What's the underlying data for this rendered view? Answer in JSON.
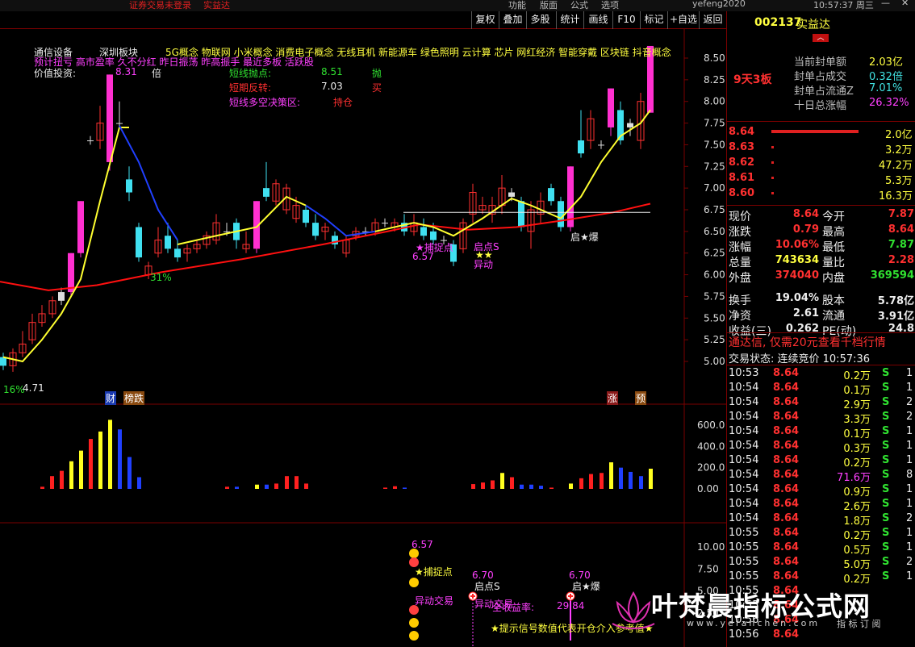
{
  "topbar": {
    "warning": "证券交易未登录",
    "stock": "实益达",
    "menu": [
      "功能",
      "版面",
      "公式",
      "选项"
    ],
    "user": "yefeng2020",
    "time": "10:57:37 周三"
  },
  "toolbar": {
    "buttons": [
      "复权",
      "叠加",
      "多股",
      "统计",
      "画线",
      "F10",
      "标记",
      "+自选",
      "返回"
    ]
  },
  "overlay": {
    "line1_a": "通信设备",
    "line1_b": "深圳板块",
    "line1_c": "5G概念 物联网 小米概念 消费电子概念 无线耳机 新能源车 绿色照明 云计算 芯片 网红经济 智能穿戴 区块链 抖音概念",
    "line2": "预计扭亏 高市盈率 久不分红 昨日振荡 昨高振手 最近多板 活跃股",
    "value_label": "价值投资:",
    "value_unit": "倍",
    "top_price": "8.31",
    "sig1_label": "短线抛点:",
    "sig1_val": "8.51",
    "sig1_act": "抛",
    "sig2_label": "短期反转:",
    "sig2_val": "7.03",
    "sig2_act": "买",
    "sig3_label": "短线多空决策区:",
    "sig3_act": "持仓"
  },
  "chart_data": {
    "type": "candlestick",
    "price_ticks": [
      "8.50",
      "8.25",
      "8.00",
      "7.75",
      "7.50",
      "7.25",
      "7.00",
      "6.75",
      "6.50",
      "6.25",
      "6.00",
      "5.75",
      "5.50",
      "5.25",
      "5.00"
    ],
    "volume_ticks": [
      "600.0",
      "400.0",
      "200.0",
      "0.00"
    ],
    "ind_ticks": [
      "10.00",
      "7.50",
      "5.00",
      "2.50"
    ],
    "annotations": {
      "low_label": "4.71",
      "pct_a": "16%",
      "pct_b": "31%",
      "mid_low": "6.57",
      "qidian": "启点S",
      "yidong": "异动",
      "baojian": "★捕捉点",
      "qibao": "启★爆",
      "cai": "财",
      "bangdie": "榜跌",
      "zhang": "涨",
      "yu": "预"
    },
    "sub": {
      "p1": "6.57",
      "p2": "6.70",
      "p3": "6.70",
      "lab_capture": "★捕捉点",
      "lab_yidong": "异动交易",
      "lab_yidong2": "异动交易",
      "lab_qidian": "启点S",
      "lab_qibao": "启★爆",
      "lab_profit": "全收益率:",
      "profit_val": "29.84",
      "note": "★提示信号数值代表开仓介入参考值★"
    }
  },
  "quote": {
    "code": "002137",
    "name": "实益达",
    "board": "9天3板",
    "seal": [
      {
        "label": "当前封单额",
        "val": "2.03亿"
      },
      {
        "label": "封单占成交",
        "val": "0.32倍"
      },
      {
        "label": "封单占流通Z",
        "val": "7.01%"
      },
      {
        "label": "十日总涨幅",
        "val": "26.32%"
      }
    ],
    "book": [
      {
        "p": "8.64",
        "v": "2.0亿"
      },
      {
        "p": "8.63",
        "v": "3.2万"
      },
      {
        "p": "8.62",
        "v": "47.2万"
      },
      {
        "p": "8.61",
        "v": "5.3万"
      },
      {
        "p": "8.60",
        "v": "16.3万"
      }
    ],
    "stats": [
      [
        "现价",
        "8.64",
        "今开",
        "7.87"
      ],
      [
        "涨跌",
        "0.79",
        "最高",
        "8.64"
      ],
      [
        "涨幅",
        "10.06%",
        "最低",
        "7.87"
      ],
      [
        "总量",
        "743634",
        "量比",
        "2.28"
      ],
      [
        "外盘",
        "374040",
        "内盘",
        "369594"
      ],
      [
        "换手",
        "19.04%",
        "股本",
        "5.78亿"
      ],
      [
        "净资",
        "2.61",
        "流通",
        "3.91亿"
      ],
      [
        "收益(三)",
        "0.262",
        "PE(动)",
        "24.8"
      ]
    ],
    "ad": "通达信, 仅需20元查看千档行情",
    "status": "交易状态: 连续竞价 10:57:36",
    "ticks": [
      [
        "10:53",
        "8.64",
        "0.2万",
        "S",
        "1"
      ],
      [
        "10:54",
        "8.64",
        "0.1万",
        "S",
        "1"
      ],
      [
        "10:54",
        "8.64",
        "2.9万",
        "S",
        "2"
      ],
      [
        "10:54",
        "8.64",
        "3.3万",
        "S",
        "2"
      ],
      [
        "10:54",
        "8.64",
        "0.1万",
        "S",
        "1"
      ],
      [
        "10:54",
        "8.64",
        "0.3万",
        "S",
        "1"
      ],
      [
        "10:54",
        "8.64",
        "0.2万",
        "S",
        "1"
      ],
      [
        "10:54",
        "8.64",
        "71.6万",
        "S",
        "8"
      ],
      [
        "10:54",
        "8.64",
        "0.9万",
        "S",
        "1"
      ],
      [
        "10:54",
        "8.64",
        "2.6万",
        "S",
        "1"
      ],
      [
        "10:54",
        "8.64",
        "1.8万",
        "S",
        "2"
      ],
      [
        "10:55",
        "8.64",
        "0.2万",
        "S",
        "1"
      ],
      [
        "10:55",
        "8.64",
        "0.5万",
        "S",
        "1"
      ],
      [
        "10:55",
        "8.64",
        "5.0万",
        "S",
        "2"
      ],
      [
        "10:55",
        "8.64",
        "0.2万",
        "S",
        "1"
      ],
      [
        "10:55",
        "8.64",
        "",
        "",
        ""
      ],
      [
        "10:55",
        "8.64",
        "",
        "",
        ""
      ],
      [
        "10:56",
        "8.64",
        "",
        "",
        ""
      ],
      [
        "10:56",
        "8.64",
        "",
        "",
        ""
      ]
    ]
  },
  "watermark": {
    "title": "叶梵晨指标公式网",
    "url": "www.yefanchen.com",
    "tag": "指 标 订 阅"
  }
}
